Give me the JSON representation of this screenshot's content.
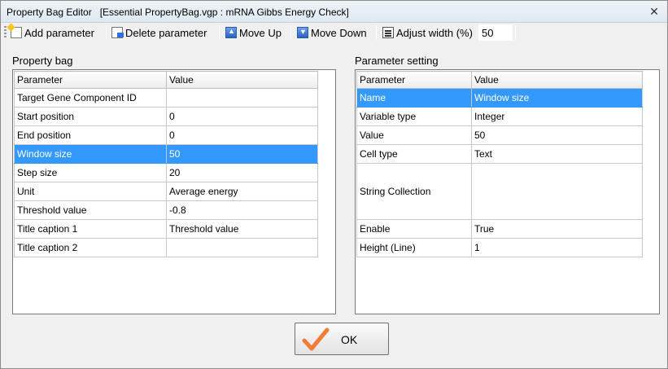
{
  "window": {
    "title": "Property Bag Editor   [Essential PropertyBag.vgp : mRNA Gibbs Energy Check]",
    "close_glyph": "✕"
  },
  "toolbar": {
    "add_label": "Add parameter",
    "delete_label": "Delete parameter",
    "move_up_label": "Move Up",
    "move_down_label": "Move Down",
    "adjust_width_label": "Adjust width (%)",
    "adjust_width_value": "50"
  },
  "property_bag": {
    "label": "Property bag",
    "headers": [
      "Parameter",
      "Value"
    ],
    "selected_index": 3,
    "rows": [
      {
        "parameter": "Target Gene Component ID",
        "value": ""
      },
      {
        "parameter": "Start position",
        "value": "0"
      },
      {
        "parameter": "End position",
        "value": "0"
      },
      {
        "parameter": "Window size",
        "value": "50"
      },
      {
        "parameter": "Step size",
        "value": "20"
      },
      {
        "parameter": "Unit",
        "value": "Average energy"
      },
      {
        "parameter": "Threshold value",
        "value": "-0.8"
      },
      {
        "parameter": "Title caption 1",
        "value": "Threshold value"
      },
      {
        "parameter": "Title caption 2",
        "value": ""
      }
    ]
  },
  "parameter_setting": {
    "label": "Parameter setting",
    "headers": [
      "Parameter",
      "Value"
    ],
    "selected_index": 0,
    "rows": [
      {
        "parameter": "Name",
        "value": "Window size"
      },
      {
        "parameter": "Variable type",
        "value": "Integer"
      },
      {
        "parameter": "Value",
        "value": "50"
      },
      {
        "parameter": "Cell type",
        "value": "Text"
      },
      {
        "parameter": "String Collection",
        "value": "",
        "tall": true
      },
      {
        "parameter": "Enable",
        "value": "True"
      },
      {
        "parameter": "Height (Line)",
        "value": "1"
      }
    ]
  },
  "ok_button": {
    "label": "OK"
  },
  "colors": {
    "selection": "#3399ff",
    "check_icon": "#f07c3a"
  },
  "icons": {
    "add": "add-document-icon",
    "delete": "delete-document-icon",
    "move_up": "arrow-up-icon",
    "move_down": "arrow-down-icon",
    "adjust_width": "adjust-width-icon",
    "ok": "checkmark-icon",
    "close": "close-icon"
  }
}
